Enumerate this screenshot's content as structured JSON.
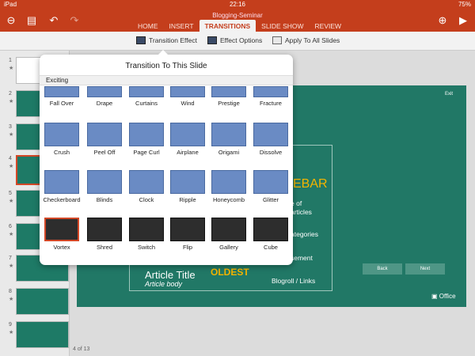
{
  "status": {
    "device": "iPad",
    "time": "22:16",
    "battery": "75%"
  },
  "ribbon": {
    "doc_title": "Blogging-Seminar",
    "tabs": [
      "HOME",
      "INSERT",
      "TRANSITIONS",
      "SLIDE SHOW",
      "REVIEW"
    ],
    "active_tab": "TRANSITIONS"
  },
  "toolbar": {
    "transition_effect": "Transition Effect",
    "effect_options": "Effect Options",
    "apply_all": "Apply To All Slides"
  },
  "popover": {
    "title": "Transition To This Slide",
    "section": "Exciting",
    "rows": [
      [
        "Fall Over",
        "Drape",
        "Curtains",
        "Wind",
        "Prestige",
        "Fracture"
      ],
      [
        "Crush",
        "Peel Off",
        "Page Curl",
        "Airplane",
        "Origami",
        "Dissolve"
      ],
      [
        "Checkerboard",
        "Blinds",
        "Clock",
        "Ripple",
        "Honeycomb",
        "Glitter"
      ],
      [
        "Vortex",
        "Shred",
        "Switch",
        "Flip",
        "Gallery",
        "Cube"
      ]
    ],
    "selected": "Vortex"
  },
  "thumbnails": [
    "1",
    "2",
    "3",
    "4",
    "5",
    "6",
    "7",
    "8",
    "9"
  ],
  "thumb_star": "★",
  "selected_slide": "4",
  "slide": {
    "exit": "Exit",
    "sidebar_heading": "EBAR",
    "items": [
      "e of",
      "articles",
      "ategories",
      "sement",
      "Blogroll / Links"
    ],
    "article_title": "Article Title",
    "article_body": "Article body",
    "oldest": "OLDEST",
    "back": "Back",
    "next": "Next",
    "office": "Office"
  },
  "page_count": "4 of 13",
  "colors": {
    "accent": "#c43e1c",
    "slide_bg": "#217866",
    "heading": "#f4b400"
  }
}
